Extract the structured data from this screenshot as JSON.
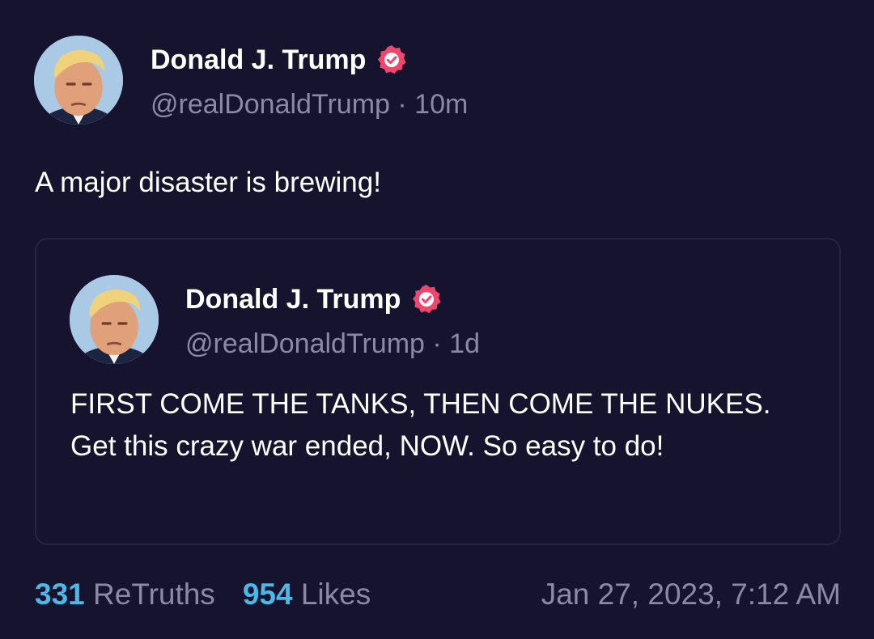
{
  "post": {
    "author_name": "Donald J. Trump",
    "handle": "@realDonaldTrump",
    "separator": " · ",
    "age": "10m",
    "text": "A major disaster is brewing!"
  },
  "quoted_post": {
    "author_name": "Donald J. Trump",
    "handle": "@realDonaldTrump",
    "separator": " · ",
    "age": "1d",
    "text": "FIRST COME THE TANKS, THEN COME THE NUKES. Get this crazy war ended, NOW. So easy to do!"
  },
  "stats": {
    "retruths_count": "331",
    "retruths_label": "ReTruths",
    "likes_count": "954",
    "likes_label": "Likes",
    "timestamp": "Jan 27, 2023, 7:12 AM"
  },
  "icons": {
    "verified": "verified-badge-icon",
    "avatar": "profile-avatar"
  },
  "colors": {
    "background": "#15132e",
    "verified": "#f0466e",
    "count_accent": "#4cb8e6",
    "muted": "#8c89a6"
  }
}
